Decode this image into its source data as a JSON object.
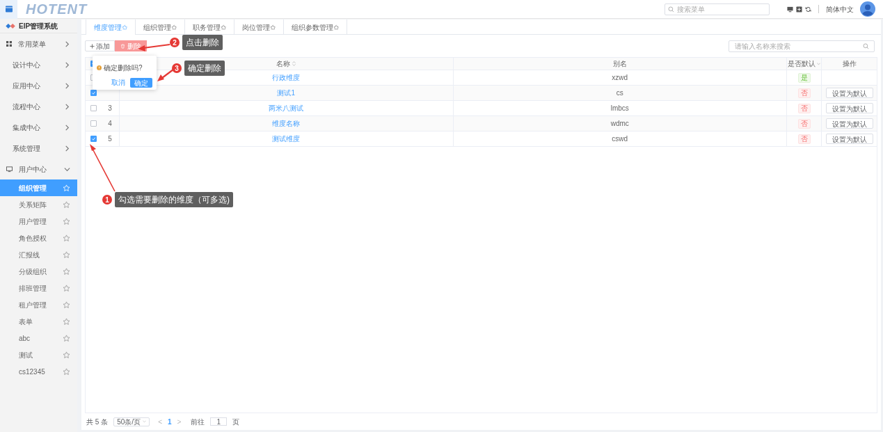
{
  "header": {
    "logo": "HOTENT",
    "search": {
      "placeholder": "搜索菜单"
    },
    "language": "简体中文"
  },
  "sidebar": {
    "system_title": "EIP管理系统",
    "items": [
      {
        "label": "常用菜单",
        "kind": "icon",
        "expanded": false
      },
      {
        "label": "设计中心",
        "kind": "plain",
        "expanded": false
      },
      {
        "label": "应用中心",
        "kind": "plain",
        "expanded": false
      },
      {
        "label": "流程中心",
        "kind": "plain",
        "expanded": false
      },
      {
        "label": "集成中心",
        "kind": "plain",
        "expanded": false
      },
      {
        "label": "系统管理",
        "kind": "plain",
        "expanded": false
      },
      {
        "label": "用户中心",
        "kind": "icon",
        "expanded": true,
        "children": [
          {
            "label": "组织管理",
            "selected": true
          },
          {
            "label": "关系矩阵",
            "selected": false
          },
          {
            "label": "用户管理",
            "selected": false
          },
          {
            "label": "角色授权",
            "selected": false
          },
          {
            "label": "汇报线",
            "selected": false
          },
          {
            "label": "分级组织",
            "selected": false
          },
          {
            "label": "排班管理",
            "selected": false
          },
          {
            "label": "租户管理",
            "selected": false
          },
          {
            "label": "表单",
            "selected": false
          },
          {
            "label": "abc",
            "selected": false
          },
          {
            "label": "测试",
            "selected": false
          },
          {
            "label": "cs12345",
            "selected": false
          }
        ]
      }
    ]
  },
  "tabs": [
    {
      "label": "维度管理✩",
      "selected": true
    },
    {
      "label": "组织管理✩",
      "selected": false
    },
    {
      "label": "职务管理✩",
      "selected": false
    },
    {
      "label": "岗位管理✩",
      "selected": false
    },
    {
      "label": "组织参数管理✩",
      "selected": false
    }
  ],
  "toolbar": {
    "add": "添加",
    "delete": "删除",
    "search": {
      "placeholder": "请输入名称来搜索"
    }
  },
  "table": {
    "columns": [
      "名称",
      "别名",
      "是否默认",
      "操作"
    ],
    "header_checkbox_indeterminate": true,
    "rows": [
      {
        "checked": false,
        "name": "行政维度",
        "alias": "xzwd",
        "is_default": true,
        "default_label": "是"
      },
      {
        "checked": true,
        "name": "测试1",
        "alias": "cs",
        "is_default": false,
        "default_label": "否",
        "action": "设置为默认"
      },
      {
        "checked": false,
        "index": "3",
        "name": "两米八测试",
        "alias": "lmbcs",
        "is_default": false,
        "default_label": "否",
        "action": "设置为默认"
      },
      {
        "checked": false,
        "index": "4",
        "name": "维度名称",
        "alias": "wdmc",
        "is_default": false,
        "default_label": "否",
        "action": "设置为默认"
      },
      {
        "checked": true,
        "index": "5",
        "name": "测试维度",
        "alias": "cswd",
        "is_default": false,
        "default_label": "否",
        "action": "设置为默认"
      }
    ]
  },
  "popconfirm": {
    "message": "确定删除吗?",
    "cancel": "取消",
    "confirm": "确定"
  },
  "pagination": {
    "total": "共 5 条",
    "page_size": "50条/页",
    "prev": "<",
    "page": "1",
    "next": ">",
    "goto": "前往",
    "goto_value": "1",
    "page_unit": "页"
  },
  "annotations": [
    {
      "number": "2",
      "text": "点击删除"
    },
    {
      "number": "3",
      "text": "确定删除"
    },
    {
      "number": "1",
      "text": "勾选需要删除的维度（可多选)"
    }
  ]
}
